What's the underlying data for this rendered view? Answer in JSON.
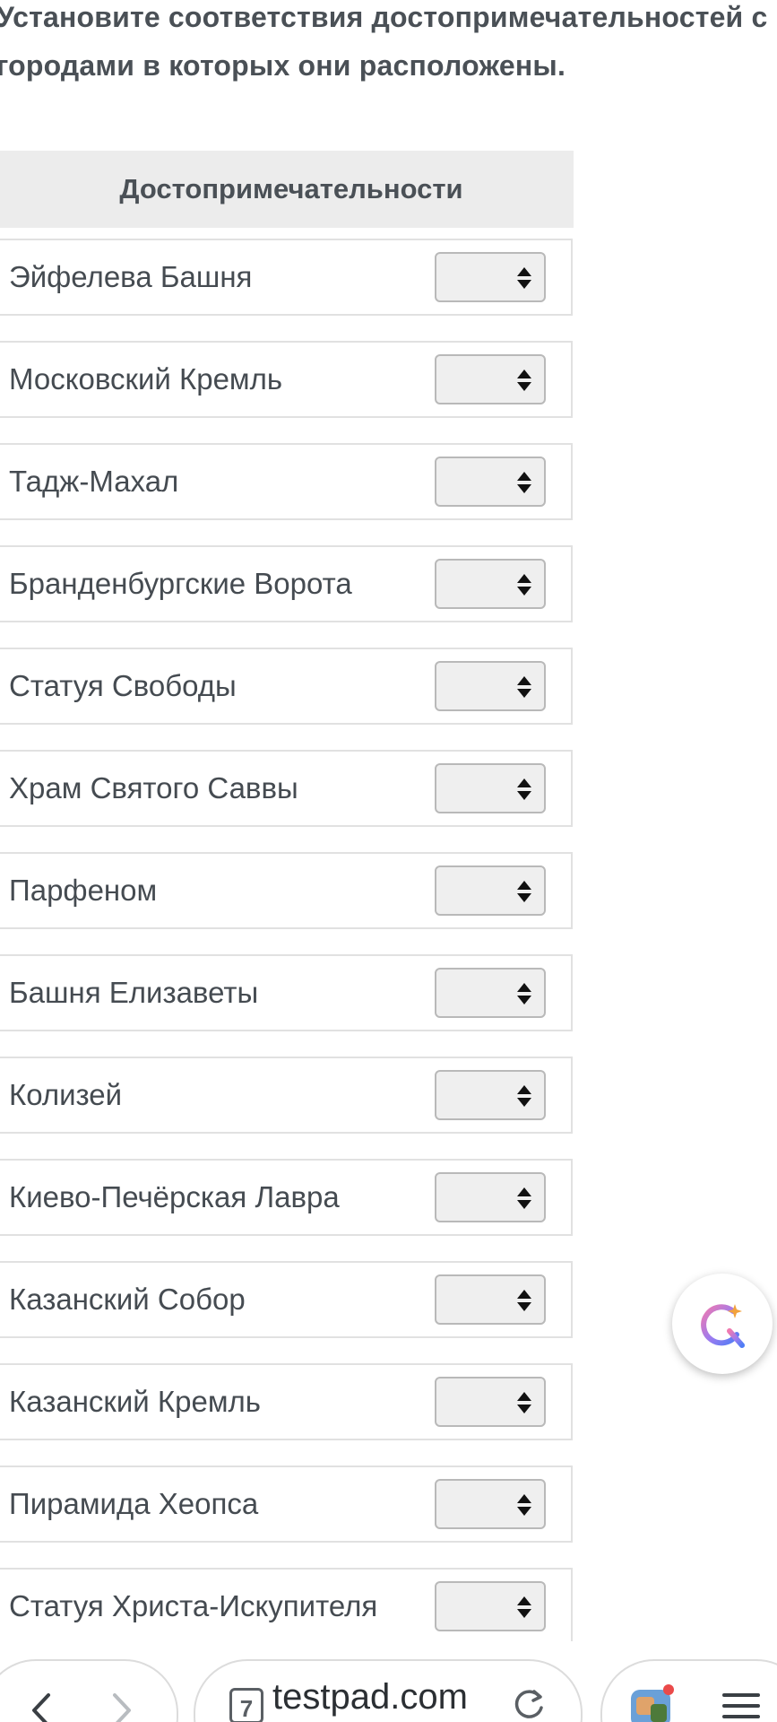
{
  "question": {
    "line1": "Установите соответствия достопримечательностей с",
    "line2": "городами в которых они расположены."
  },
  "table": {
    "header": "Достопримечательности",
    "rows": [
      {
        "label": "Эйфелева Башня",
        "selected": ""
      },
      {
        "label": "Московский Кремль",
        "selected": ""
      },
      {
        "label": "Тадж-Махал",
        "selected": ""
      },
      {
        "label": "Бранденбургские Ворота",
        "selected": ""
      },
      {
        "label": "Статуя Свободы",
        "selected": ""
      },
      {
        "label": "Храм Святого Саввы",
        "selected": ""
      },
      {
        "label": "Парфеном",
        "selected": ""
      },
      {
        "label": "Башня Елизаветы",
        "selected": ""
      },
      {
        "label": "Колизей",
        "selected": ""
      },
      {
        "label": "Киево-Печёрская Лавра",
        "selected": ""
      },
      {
        "label": "Казанский Собор",
        "selected": ""
      },
      {
        "label": "Казанский Кремль",
        "selected": ""
      },
      {
        "label": "Пирамида Хеопса",
        "selected": ""
      },
      {
        "label": "Статуя Христа-Искупителя",
        "selected": ""
      }
    ]
  },
  "assistant_button": {
    "icon": "assistant-q-icon"
  },
  "browser_bar": {
    "tab_count": "7",
    "url": "testpad.com",
    "back_icon": "chevron-left-icon",
    "forward_icon": "chevron-right-icon",
    "reload_icon": "reload-icon",
    "extension_icon": "game-extension-icon",
    "menu_icon": "hamburger-menu-icon"
  },
  "colors": {
    "text": "#454b51",
    "header_bg": "#ececec",
    "select_bg": "#efefef",
    "border": "#e1e1e1"
  }
}
